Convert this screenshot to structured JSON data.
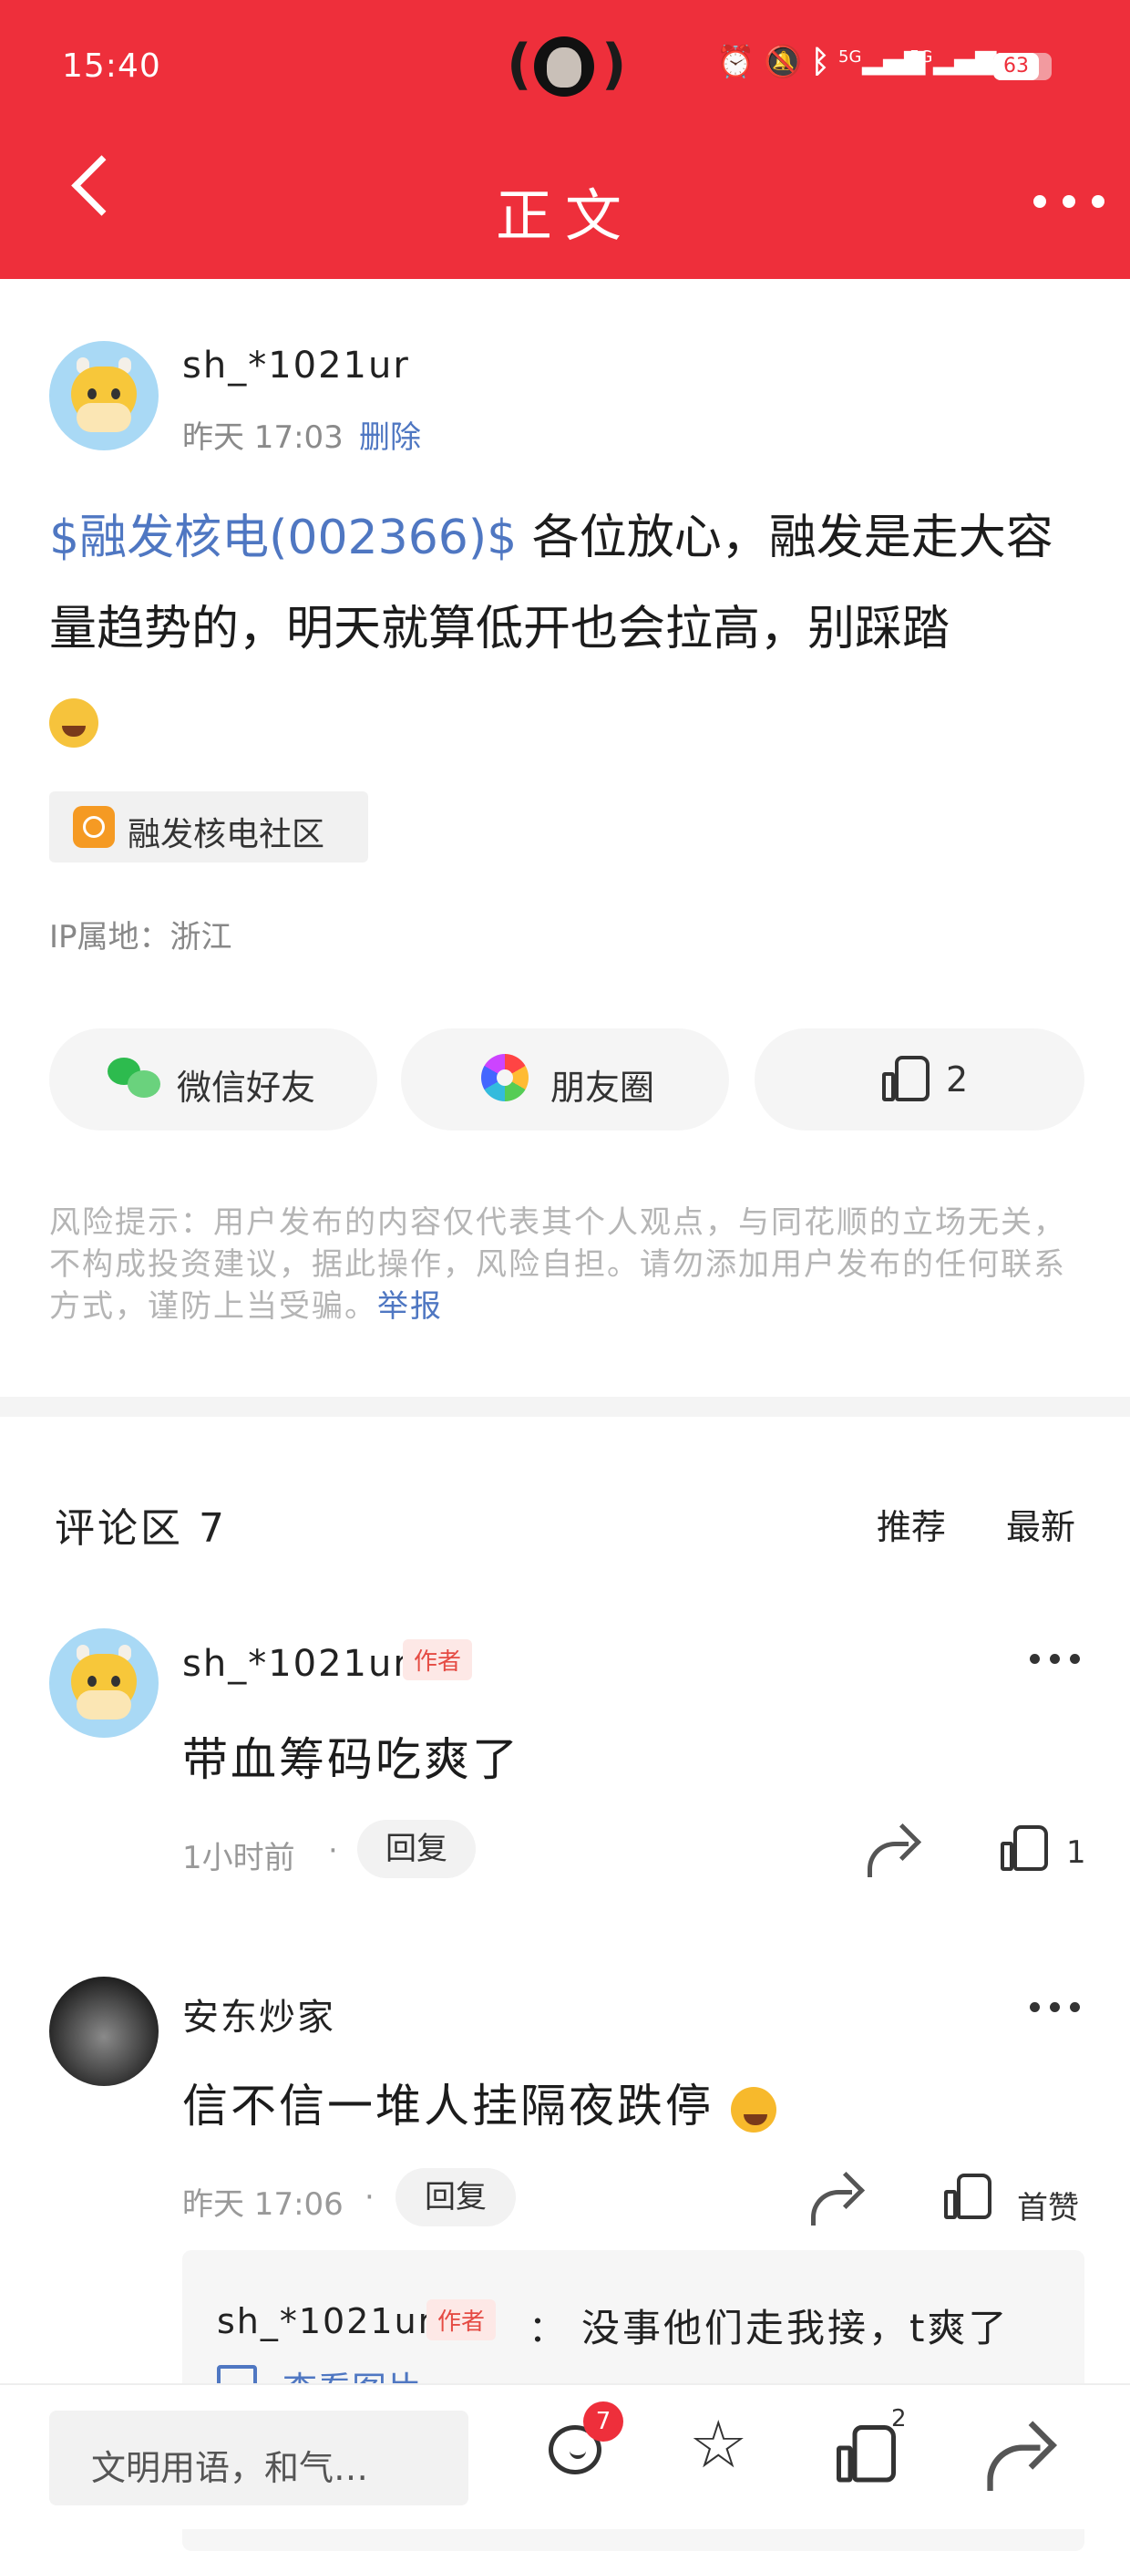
{
  "status_bar": {
    "time": "15:40",
    "battery": "63",
    "net_1": "5G",
    "net_2": "5G"
  },
  "header": {
    "title": "正文"
  },
  "post": {
    "author": "sh_*1021ur",
    "time": "昨天 17:03",
    "delete_label": "删除",
    "stock_tag": "$融发核电(002366)$",
    "body": " 各位放心，融发是走大容量趋势的，明天就算低开也会拉高，别踩踏",
    "community": "融发核电社区",
    "ip": "IP属地：浙江"
  },
  "share": {
    "wechat_label": "微信好友",
    "moments_label": "朋友圈",
    "like_count": "2"
  },
  "risk": {
    "text": "风险提示：用户发布的内容仅代表其个人观点，与同花顺的立场无关，不构成投资建议，据此操作，风险自担。请勿添加用户发布的任何联系方式，谨防上当受骗。",
    "report": "举报"
  },
  "comments": {
    "title": "评论区 7",
    "sort_recommend": "推荐",
    "sort_latest": "最新",
    "items": [
      {
        "author": "sh_*1021ur",
        "badge": "作者",
        "text": "带血筹码吃爽了",
        "time": "1小时前",
        "reply": "回复",
        "likes": "1"
      },
      {
        "author": "安东炒家",
        "text": "信不信一堆人挂隔夜跌停",
        "time": "昨天 17:06",
        "reply": "回复",
        "likes": "首赞"
      }
    ],
    "sub_reply": {
      "author": "sh_*1021ur",
      "badge": "作者",
      "sep": "：",
      "text": "没事他们走我接，t爽了",
      "view_image": "查看图片"
    }
  },
  "bottom": {
    "input_placeholder": "文明用语，和气…",
    "comment_count": "7",
    "like_count": "2"
  },
  "colors": {
    "brand_red": "#ee2f3b",
    "link_blue": "#4f77c2"
  }
}
